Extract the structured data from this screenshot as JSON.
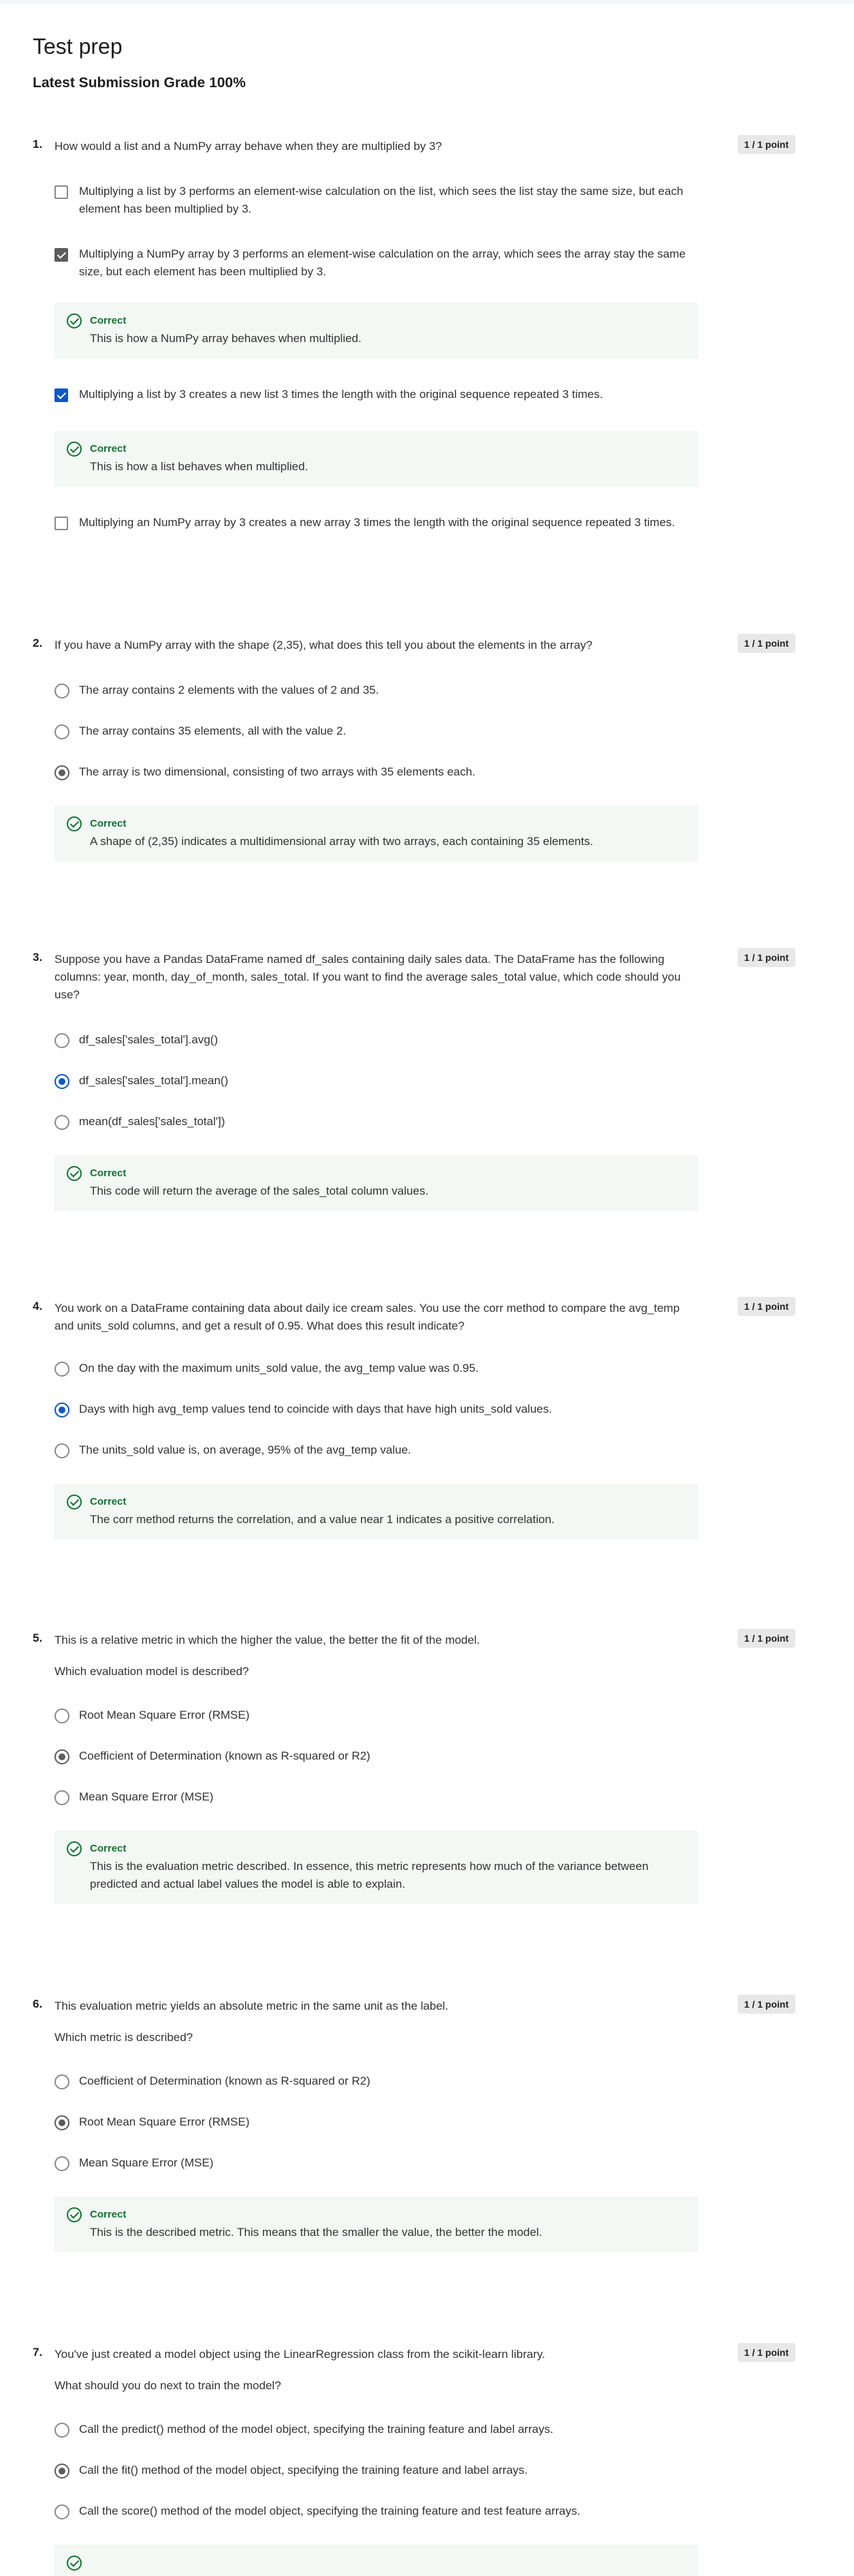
{
  "page": {
    "title": "Test prep",
    "grade": "Latest Submission Grade 100%"
  },
  "questions": [
    {
      "num": "1.",
      "text": "How would a list and a NumPy array behave when they are multiplied by 3?",
      "points": "1 / 1 point",
      "options": [
        "Multiplying a list by 3 performs an element-wise calculation on the list, which sees the list stay the same size, but each element has been multiplied by 3.",
        "Multiplying a NumPy array by 3 performs an element-wise calculation on the array, which sees the array stay the same size, but each element has been multiplied by 3.",
        "Multiplying a list by 3 creates a new list 3 times the length with the original sequence repeated 3 times.",
        "Multiplying an NumPy array by 3 creates a new array 3 times the length with the original sequence repeated 3 times."
      ],
      "feedback": [
        {
          "title": "Correct",
          "text": "This is how a NumPy array behaves when multiplied."
        },
        {
          "title": "Correct",
          "text": "This is how a list behaves when multiplied."
        }
      ]
    },
    {
      "num": "2.",
      "text": "If you have a NumPy array with the shape (2,35), what does this tell you about the elements in the array?",
      "points": "1 / 1 point",
      "options": [
        "The array contains 2 elements with the values of 2 and 35.",
        "The array contains 35 elements, all with the value 2.",
        "The array is two dimensional, consisting of two arrays with 35 elements each."
      ],
      "feedback": {
        "title": "Correct",
        "text": "A shape of (2,35) indicates a multidimensional array with two arrays, each containing 35 elements."
      }
    },
    {
      "num": "3.",
      "text": "Suppose you have a Pandas DataFrame named df_sales containing daily sales data. The DataFrame has the following columns: year, month, day_of_month, sales_total. If you want to find the average sales_total value, which code should you use?",
      "points": "1 / 1 point",
      "options": [
        "df_sales['sales_total'].avg()",
        "df_sales['sales_total'].mean()",
        "mean(df_sales['sales_total'])"
      ],
      "feedback": {
        "title": "Correct",
        "text": "This code will return the average of the sales_total column values."
      }
    },
    {
      "num": "4.",
      "text": "You work on a DataFrame containing data about daily ice cream sales. You use the corr method to compare the avg_temp and units_sold columns, and get a result of 0.95. What does this result indicate?",
      "points": "1 / 1 point",
      "options": [
        "On the day with the maximum units_sold value, the avg_temp value was 0.95.",
        "Days with high avg_temp values tend to coincide with days that have high units_sold values.",
        "The units_sold value is, on average, 95% of the avg_temp value."
      ],
      "feedback": {
        "title": "Correct",
        "text": "The corr method returns the correlation, and a value near 1 indicates a positive correlation."
      }
    },
    {
      "num": "5.",
      "text": "This is a relative metric in which the higher the value, the better the fit of the model.",
      "sub": "Which evaluation model is described?",
      "points": "1 / 1 point",
      "options": [
        "Root Mean Square Error (RMSE)",
        "Coefficient of Determination (known as R-squared or R2)",
        "Mean Square Error (MSE)"
      ],
      "feedback": {
        "title": "Correct",
        "text": "This is the evaluation metric described. In essence, this metric represents how much of the variance between predicted and actual label values the model is able to explain."
      }
    },
    {
      "num": "6.",
      "text": "This evaluation metric yields an absolute metric in the same unit as the label.",
      "sub": "Which metric is described?",
      "points": "1 / 1 point",
      "options": [
        "Coefficient of Determination (known as R-squared or R2)",
        "Root Mean Square Error (RMSE)",
        "Mean Square Error (MSE)"
      ],
      "feedback": {
        "title": "Correct",
        "text": "This is the described metric. This means that the smaller the value, the better the model."
      }
    },
    {
      "num": "7.",
      "text": "You've just created a model object using the LinearRegression class from the scikit-learn library.",
      "sub": "What should you do next to train the model?",
      "points": "1 / 1 point",
      "options": [
        "Call the predict() method of the model object, specifying the training feature and label arrays.",
        "Call the fit() method of the model object, specifying the training feature and label arrays.",
        "Call the score() method of the model object, specifying the training feature and test feature arrays."
      ]
    }
  ]
}
